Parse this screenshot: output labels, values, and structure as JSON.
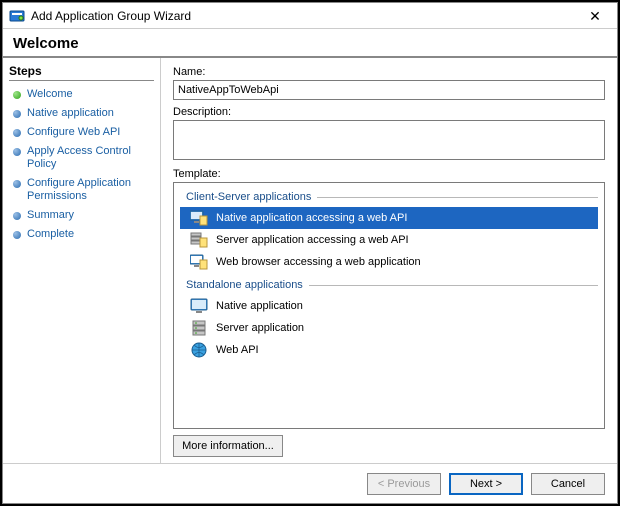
{
  "window": {
    "title": "Add Application Group Wizard",
    "close_glyph": "✕"
  },
  "header": {
    "title": "Welcome"
  },
  "sidebar": {
    "heading": "Steps",
    "items": [
      {
        "label": "Welcome",
        "state": "current"
      },
      {
        "label": "Native application",
        "state": "pending"
      },
      {
        "label": "Configure Web API",
        "state": "pending"
      },
      {
        "label": "Apply Access Control Policy",
        "state": "pending"
      },
      {
        "label": "Configure Application Permissions",
        "state": "pending"
      },
      {
        "label": "Summary",
        "state": "pending"
      },
      {
        "label": "Complete",
        "state": "pending"
      }
    ]
  },
  "form": {
    "name_label": "Name:",
    "name_value": "NativeAppToWebApi",
    "desc_label": "Description:",
    "desc_value": "",
    "template_label": "Template:",
    "more_info_label": "More information..."
  },
  "templates": {
    "groups": [
      {
        "title": "Client-Server applications",
        "items": [
          {
            "icon": "native-web-icon",
            "label": "Native application accessing a web API",
            "selected": true
          },
          {
            "icon": "server-web-icon",
            "label": "Server application accessing a web API",
            "selected": false
          },
          {
            "icon": "browser-web-icon",
            "label": "Web browser accessing a web application",
            "selected": false
          }
        ]
      },
      {
        "title": "Standalone applications",
        "items": [
          {
            "icon": "native-app-icon",
            "label": "Native application",
            "selected": false
          },
          {
            "icon": "server-app-icon",
            "label": "Server application",
            "selected": false
          },
          {
            "icon": "web-api-icon",
            "label": "Web API",
            "selected": false
          }
        ]
      }
    ]
  },
  "footer": {
    "previous": "< Previous",
    "next": "Next >",
    "cancel": "Cancel"
  }
}
